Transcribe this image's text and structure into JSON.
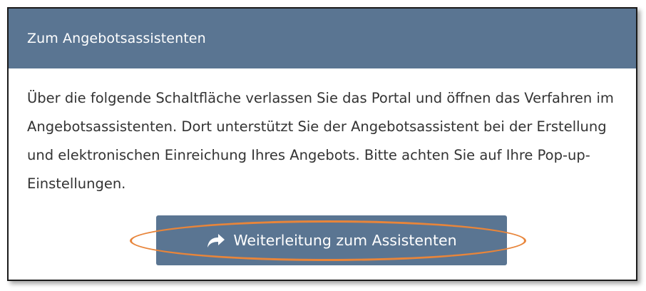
{
  "panel": {
    "title": "Zum Angebotsassistenten",
    "description": "Über die folgende Schaltfläche verlassen Sie das Portal und öffnen das Verfahren im Angebotsassistenten. Dort unterstützt Sie der Angebotsassistent bei der Erstellung und elektronischen Einreichung Ihres Angebots. Bitte achten Sie auf Ihre Pop-up-Einstellungen.",
    "button": {
      "label": "Weiterleitung zum Assistenten",
      "icon": "share-icon"
    }
  },
  "colors": {
    "header_bg": "#5a7592",
    "button_bg": "#5a7592",
    "highlight": "#e8853a",
    "text": "#333333"
  }
}
